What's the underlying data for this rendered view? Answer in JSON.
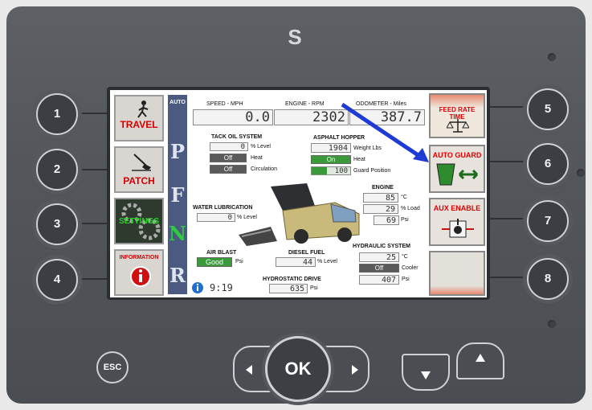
{
  "device": {
    "logo": "S",
    "side_buttons_left": [
      "1",
      "2",
      "3",
      "4"
    ],
    "side_buttons_right": [
      "5",
      "6",
      "7",
      "8"
    ],
    "esc_label": "ESC",
    "ok_label": "OK"
  },
  "left_menu": {
    "travel": "TRAVEL",
    "patch": "PATCH",
    "settings": "SETTINGS",
    "information": "INFORMATION"
  },
  "mode_strip": {
    "auto": "AUTO",
    "letters": [
      "P",
      "F",
      "N",
      "R"
    ]
  },
  "top_readouts": {
    "speed_label": "SPEED - MPH",
    "speed_value": "0.0",
    "engine_label": "ENGINE - RPM",
    "engine_value": "2302",
    "odometer_label": "ODOMETER - Miles",
    "odometer_value": "387.7"
  },
  "tack_oil": {
    "title": "TACK OIL SYSTEM",
    "level_value": "0",
    "level_unit": "% Level",
    "heat_state": "Off",
    "heat_label": "Heat",
    "circulation_state": "Off",
    "circulation_label": "Circulation"
  },
  "asphalt_hopper": {
    "title": "ASPHALT HOPPER",
    "weight_value": "1904",
    "weight_unit": "Weight Lbs",
    "heat_state": "On",
    "heat_label": "Heat",
    "guard_value": "100",
    "guard_label": "Guard Position"
  },
  "water_lubrication": {
    "title": "WATER LUBRICATION",
    "level_value": "0",
    "level_unit": "% Level"
  },
  "engine": {
    "title": "ENGINE",
    "temp_value": "85",
    "temp_unit": "°C",
    "load_value": "29",
    "load_unit": "% Load",
    "psi_value": "69",
    "psi_unit": "Psi"
  },
  "air_blast": {
    "title": "AIR BLAST",
    "state": "Good",
    "unit": "Psi"
  },
  "diesel_fuel": {
    "title": "DIESEL FUEL",
    "value": "44",
    "unit": "% Level"
  },
  "hydraulic": {
    "title": "HYDRAULIC SYSTEM",
    "temp_value": "25",
    "temp_unit": "°C",
    "cooler_state": "Off",
    "cooler_label": "Cooler",
    "psi_value": "407",
    "psi_unit": "Psi"
  },
  "hydrostatic": {
    "title": "HYDROSTATIC DRIVE",
    "value": "635",
    "unit": "Psi"
  },
  "clock": "9:19",
  "right_menu": {
    "feed_rate": "FEED RATE TIME",
    "auto_guard": "AUTO GUARD",
    "aux_enable": "AUX ENABLE"
  },
  "colors": {
    "label_red": "#e00000",
    "on_green": "#3a9a3a",
    "off_gray": "#5a5a5a",
    "arrow_blue": "#1f3bd6"
  }
}
